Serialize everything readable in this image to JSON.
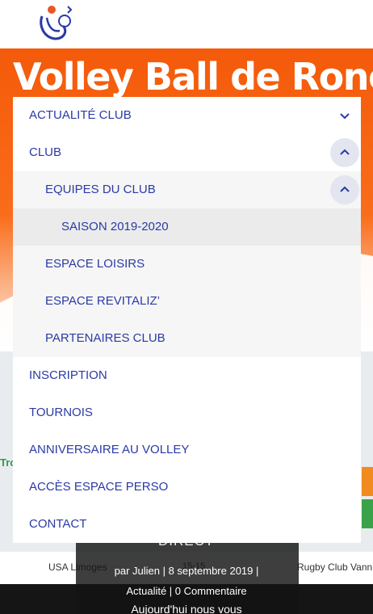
{
  "hero": {
    "title": "Volley Ball de Roncq"
  },
  "menu": {
    "items": [
      {
        "label": "ACTUALITÉ CLUB",
        "toggle": "chevron-down-icon"
      },
      {
        "label": "CLUB",
        "toggle": "chevron-up-icon"
      },
      {
        "label": "EQUIPES DU CLUB",
        "toggle": "chevron-up-icon"
      },
      {
        "label": "SAISON 2019-2020"
      },
      {
        "label": "ESPACE LOISIRS"
      },
      {
        "label": "ESPACE REVITALIZ’"
      },
      {
        "label": "PARTENAIRES CLUB"
      },
      {
        "label": "INSCRIPTION"
      },
      {
        "label": "TOURNOIS"
      },
      {
        "label": "ANNIVERSAIRE AU VOLLEY"
      },
      {
        "label": "ACCÈS ESPACE PERSO"
      },
      {
        "label": "CONTACT"
      }
    ]
  },
  "post": {
    "headline_partial": "DIRECT",
    "meta_line": "par Julien | 8 septembre 2019 |",
    "category_line": "Actualité | 0 Commentaire",
    "excerpt_partial": "Aujourd'hui nous vous"
  },
  "background": {
    "score_left": "USA Limoges",
    "score_mid": "15-15",
    "score_right": "Rugby Club Vann",
    "edge_text": "Tro"
  },
  "colors": {
    "accent": "#2b3aa6",
    "hero_orange": "#f45a0a"
  }
}
